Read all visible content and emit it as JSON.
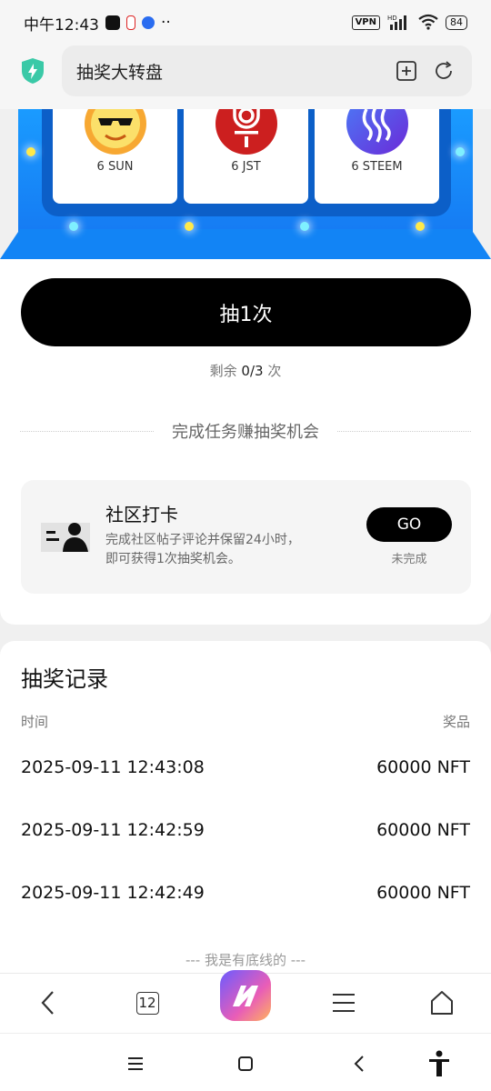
{
  "status_bar": {
    "time": "中午12:43",
    "dots": "··",
    "vpn": "VPN",
    "network": "HD",
    "battery": "84"
  },
  "browser": {
    "title": "抽奖大转盘",
    "tab_count": "12"
  },
  "prizes": [
    {
      "label": "6 SUN",
      "icon": "sun-token-icon"
    },
    {
      "label": "6 JST",
      "icon": "jst-token-icon"
    },
    {
      "label": "6 STEEM",
      "icon": "steem-token-icon"
    }
  ],
  "draw": {
    "button_label": "抽1次",
    "remaining_prefix": "剩余",
    "remaining_value": "0/3",
    "remaining_suffix": "次"
  },
  "tasks": {
    "section_title": "完成任务赚抽奖机会",
    "items": [
      {
        "title": "社区打卡",
        "desc_line1": "完成社区帖子评论并保留24小时，",
        "desc_line2": "即可获得1次抽奖机会。",
        "action_label": "GO",
        "status": "未完成"
      }
    ]
  },
  "records": {
    "title": "抽奖记录",
    "col_time": "时间",
    "col_prize": "奖品",
    "rows": [
      {
        "time": "2025-09-11 12:43:08",
        "prize": "60000 NFT"
      },
      {
        "time": "2025-09-11 12:42:59",
        "prize": "60000 NFT"
      },
      {
        "time": "2025-09-11 12:42:49",
        "prize": "60000 NFT"
      }
    ],
    "end_note": "--- 我是有底线的 ---"
  },
  "colors": {
    "hero_blue": "#1a9bff",
    "frame_blue": "#0c5fc8",
    "shield_green": "#3ac9a7",
    "button_black": "#000000",
    "light_cyan": "#7ff0ff",
    "light_yellow": "#ffe94a"
  }
}
